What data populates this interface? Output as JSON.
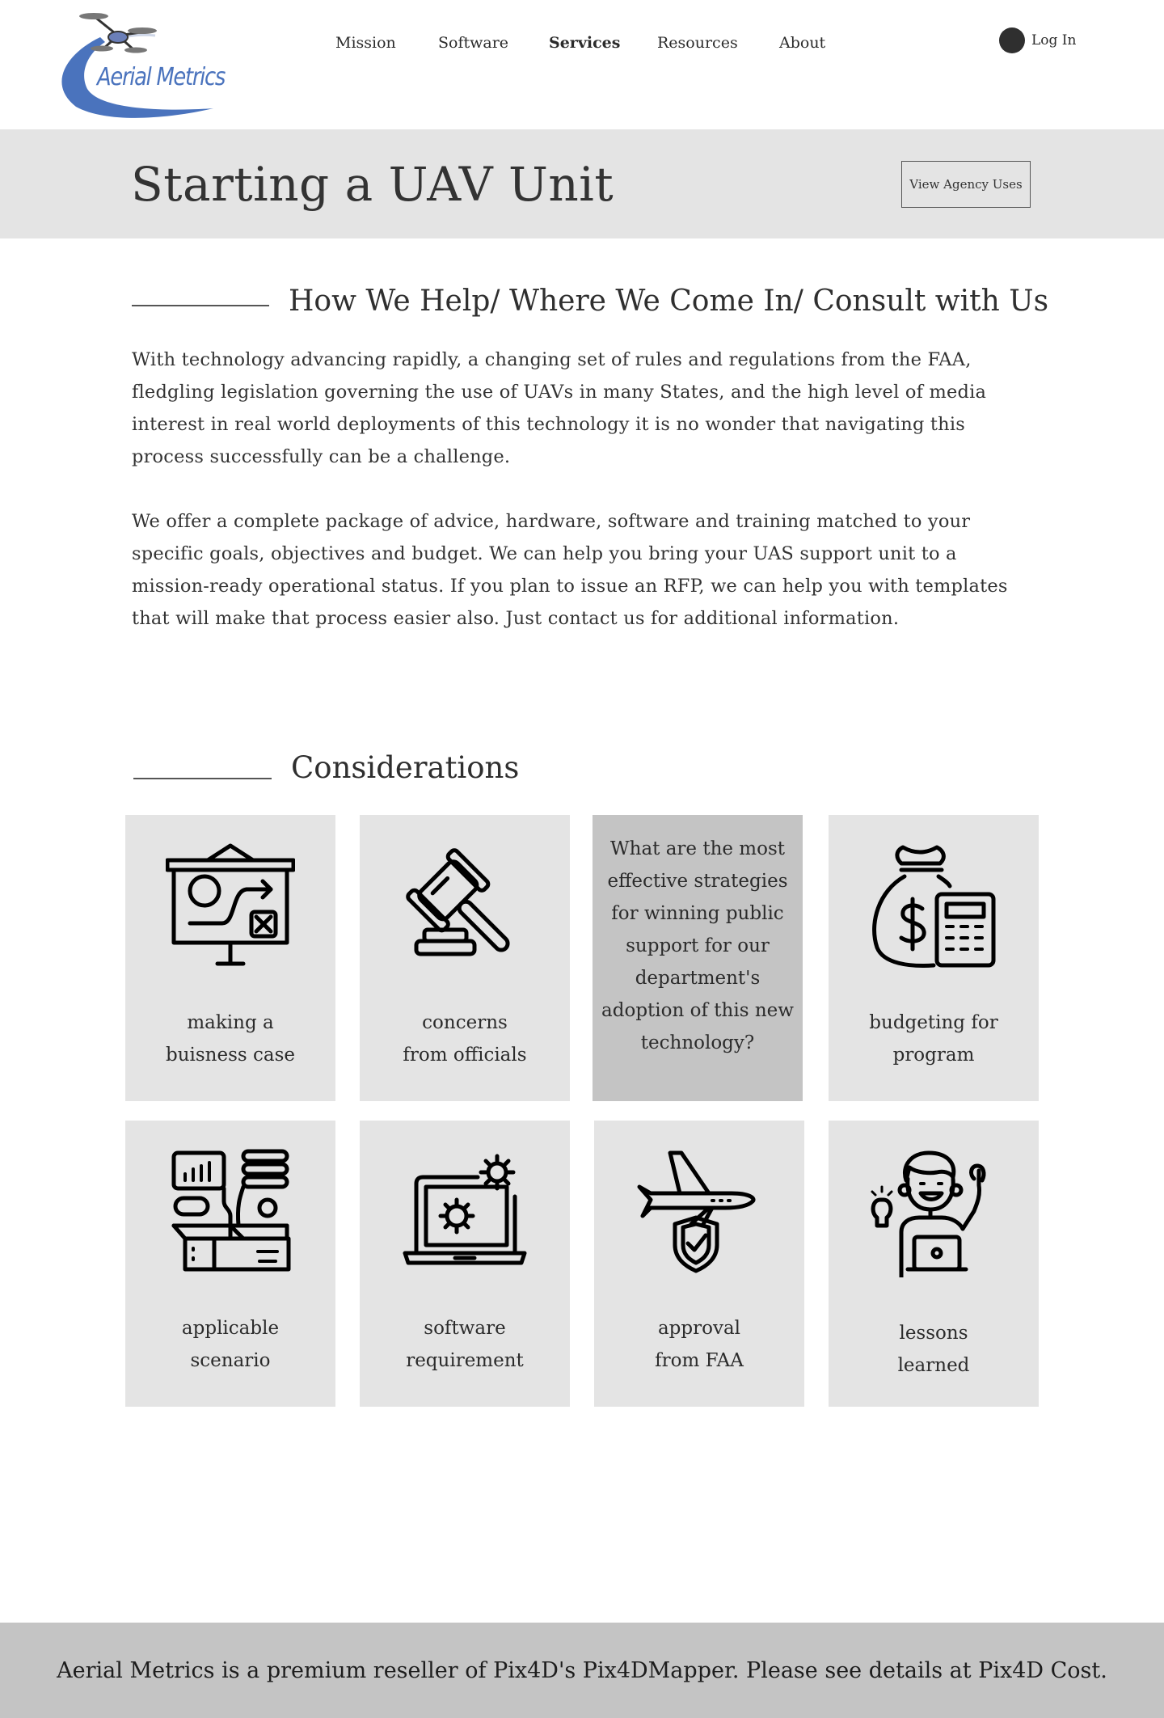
{
  "header": {
    "logo_text": "Aerial Metrics",
    "nav": {
      "mission": "Mission",
      "software": "Software",
      "services": "Services",
      "resources": "Resources",
      "about": "About"
    },
    "login_label": "Log In"
  },
  "title_band": {
    "title": "Starting a UAV Unit",
    "button_label": "View Agency Uses"
  },
  "help_section": {
    "heading": "How We Help/ Where We Come In/ Consult with Us",
    "paragraph_1": "With technology advancing rapidly, a changing set of rules and regulations from the FAA, fledgling legislation governing the use of UAVs in many States, and the high level of media interest in real world deployments of this technology it is no wonder that navigating this process successfully can be a challenge.",
    "paragraph_2": "We offer a complete package of advice, hardware, software and training matched to your specific goals, objectives and budget.  We can help you bring your UAS support unit to a mission-ready operational status.  If you plan to issue an RFP, we can help you with templates that will make that process easier also.  Just contact us for additional information."
  },
  "considerations": {
    "heading": "Considerations",
    "cards": [
      {
        "label_1": "making a",
        "label_2": "buisness case",
        "icon": "presentation-board-icon"
      },
      {
        "label_1": "concerns",
        "label_2": "from officials",
        "icon": "gavel-icon"
      },
      {
        "question": "What are the most effective strategies for winning public support for our department's adoption of this new technology?"
      },
      {
        "label_1": "budgeting for",
        "label_2": "program",
        "icon": "money-bag-calculator-icon"
      },
      {
        "label_1": "applicable",
        "label_2": "scenario",
        "icon": "analytics-box-icon"
      },
      {
        "label_1": "software",
        "label_2": "requirement",
        "icon": "laptop-gears-icon"
      },
      {
        "label_1": "approval",
        "label_2": "from FAA",
        "icon": "airplane-shield-icon"
      },
      {
        "label_1": "lessons",
        "label_2": "learned",
        "icon": "person-idea-icon"
      }
    ]
  },
  "colors": {
    "logo_blue": "#4a73bd",
    "band_gray": "#e4e4e4",
    "highlight_gray": "#c4c4c4",
    "footer_gray": "#c4c4c4"
  },
  "footer": {
    "text": "Aerial Metrics is a premium reseller of Pix4D's Pix4DMapper.  Please see details at Pix4D Cost."
  }
}
